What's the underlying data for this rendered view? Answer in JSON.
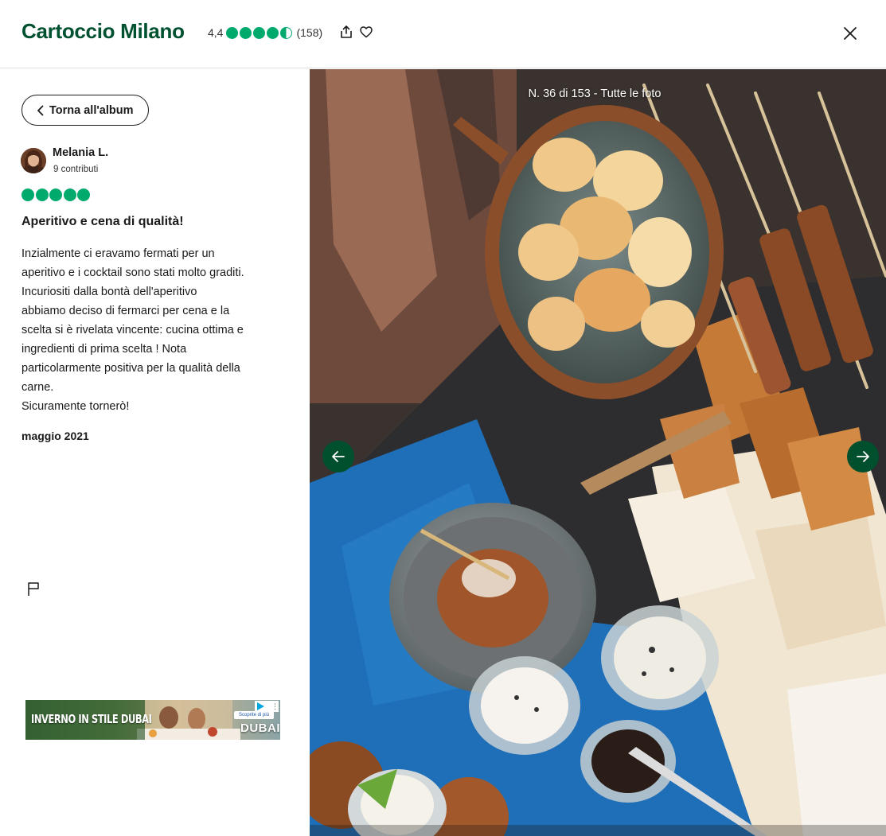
{
  "header": {
    "title": "Cartoccio Milano",
    "rating": "4,4",
    "bubble_score": 4.5,
    "review_count": "(158)",
    "share_icon": "share-icon",
    "heart_icon": "heart-icon",
    "close_icon": "close-icon"
  },
  "sidebar": {
    "back_label": "Torna all'album",
    "user": {
      "name": "Melania L.",
      "contributions": "9 contributi"
    },
    "review": {
      "bubbles": 5,
      "title": "Aperitivo e cena di qualità!",
      "body": "Inzialmente ci eravamo fermati per un\naperitivo e i cocktail sono stati molto graditi.\nIncuriositi dalla bontà dell'aperitivo\nabbiamo deciso di fermarci per cena e la\nscelta si è rivelata vincente: cucina ottima e\ningredienti di prima scelta ! Nota\nparticolarmente positiva per la qualità della\ncarne.\nSicuramente tornerò!",
      "date": "maggio 2021"
    },
    "flag_icon": "flag-icon",
    "ad": {
      "text": "INVERNO IN STILE DUBAI",
      "cta": "Scoprite di più",
      "brand": "DUBAI"
    }
  },
  "viewer": {
    "counter": "N. 36 di 153 - Tutte le foto",
    "prev_icon": "arrow-left-icon",
    "next_icon": "arrow-right-icon"
  },
  "colors": {
    "brand_green": "#00512f",
    "bubble_green": "#00aa6c",
    "nav_green": "#004f2d"
  }
}
